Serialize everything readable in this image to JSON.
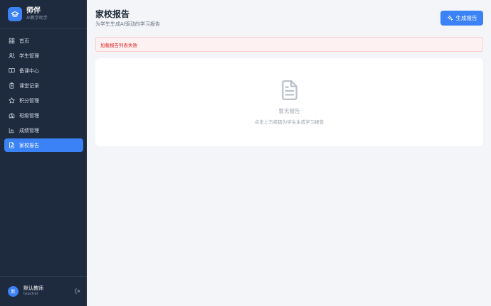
{
  "app": {
    "name": "师伴",
    "tagline": "AI教学助手",
    "accent": "#3b82f6"
  },
  "nav": [
    {
      "label": "首页",
      "icon": "grid-icon"
    },
    {
      "label": "学生管理",
      "icon": "users-icon"
    },
    {
      "label": "备课中心",
      "icon": "book-open-icon"
    },
    {
      "label": "课堂记录",
      "icon": "clipboard-icon"
    },
    {
      "label": "积分管理",
      "icon": "star-icon"
    },
    {
      "label": "班级管理",
      "icon": "school-icon"
    },
    {
      "label": "成绩管理",
      "icon": "bar-chart-icon"
    },
    {
      "label": "家校报告",
      "icon": "file-text-icon",
      "active": true
    }
  ],
  "user": {
    "avatar_text": "默",
    "name": "默认教师",
    "role": "teacher"
  },
  "header": {
    "title": "家校报告",
    "subtitle": "为学生生成AI驱动的学习报告",
    "generate_label": "生成报告"
  },
  "alert": {
    "message": "加载报告列表失败",
    "color": "#dc2626"
  },
  "empty": {
    "title": "暂无报告",
    "subtitle": "点击上方按钮为学生生成学习报告"
  }
}
